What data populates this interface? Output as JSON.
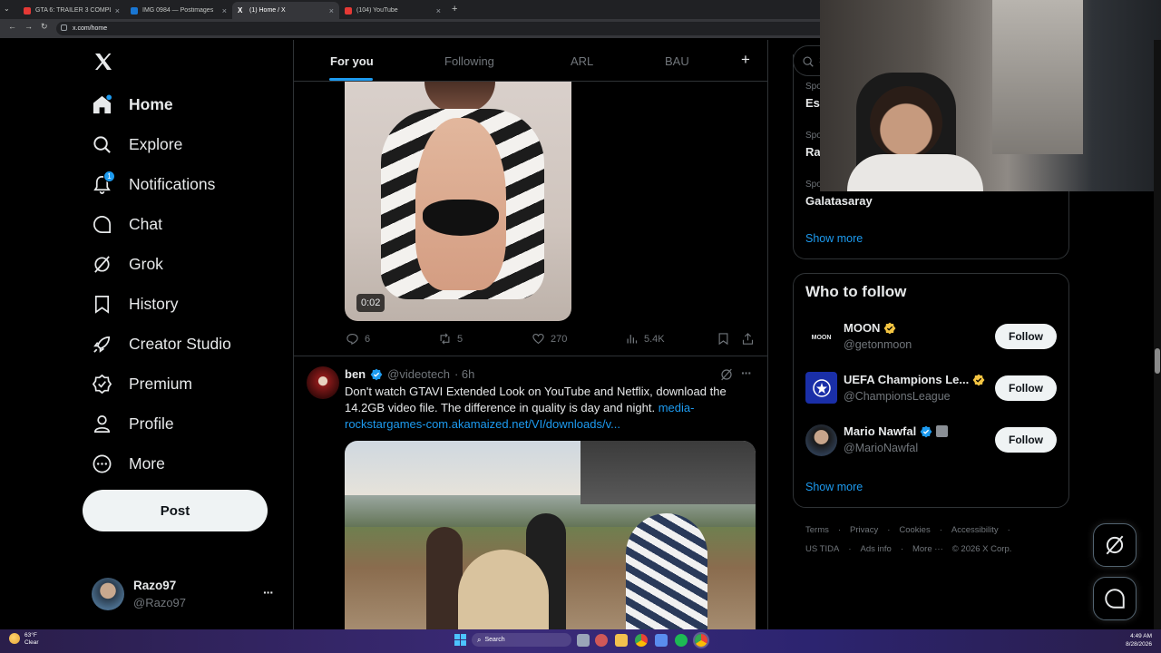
{
  "browser": {
    "tabs": [
      {
        "title": "GTA 6: TRAILER 3 COMPLETO! | ...",
        "favicon_color": "#e53935"
      },
      {
        "title": "IMG 0984 — Postimages",
        "favicon_color": "#1976d2"
      },
      {
        "title": "(1) Home / X",
        "favicon_color": "#ffffff"
      },
      {
        "title": "(104) YouTube",
        "favicon_color": "#e53935"
      }
    ],
    "url": "x.com/home"
  },
  "sidebar": {
    "logo": "X",
    "items": [
      {
        "label": "Home",
        "icon": "home-icon"
      },
      {
        "label": "Explore",
        "icon": "search-icon"
      },
      {
        "label": "Notifications",
        "icon": "bell-icon",
        "badge": "1"
      },
      {
        "label": "Chat",
        "icon": "chat-icon"
      },
      {
        "label": "Grok",
        "icon": "grok-icon"
      },
      {
        "label": "History",
        "icon": "bookmark-icon"
      },
      {
        "label": "Creator Studio",
        "icon": "rocket-icon"
      },
      {
        "label": "Premium",
        "icon": "verified-icon"
      },
      {
        "label": "Profile",
        "icon": "person-icon"
      },
      {
        "label": "More",
        "icon": "more-circle-icon"
      }
    ],
    "post_label": "Post",
    "account": {
      "name": "Razo97",
      "handle": "@Razo97",
      "menu": "···"
    }
  },
  "feed": {
    "tabs": [
      "For you",
      "Following",
      "ARL",
      "BAU"
    ],
    "add_tab": "+",
    "post1": {
      "video_duration": "0:02",
      "replies": "6",
      "reposts": "5",
      "likes": "270",
      "views": "5.4K"
    },
    "post2": {
      "name": "ben",
      "handle": "@videotech",
      "time": "· 6h",
      "text": "Don't watch GTAVI Extended Look on YouTube and Netflix, download the 14.2GB video file. The difference in quality is day and night.",
      "link": "media-rockstargames-com.akamaized.net/VI/downloads/v..."
    }
  },
  "right": {
    "search_placeholder": "S",
    "trends": [
      {
        "category": "Spo",
        "name": "Est"
      },
      {
        "category": "Spo",
        "name": "Ra"
      },
      {
        "category": "Spo",
        "name": "Galatasaray"
      }
    ],
    "trends_show_more": "Show more",
    "who_to_follow": {
      "title": "Who to follow",
      "accounts": [
        {
          "name": "MOON",
          "handle": "@getonmoon",
          "avatar_text": "MOON"
        },
        {
          "name": "UEFA Champions Le...",
          "handle": "@ChampionsLeague",
          "avatar_text": ""
        },
        {
          "name": "Mario Nawfal",
          "handle": "@MarioNawfal",
          "avatar_text": ""
        }
      ],
      "follow_label": "Follow",
      "show_more": "Show more"
    },
    "footer": {
      "row1": [
        "Terms",
        "Privacy",
        "Cookies",
        "Accessibility"
      ],
      "row2": [
        "US TIDA",
        "Ads info",
        "More ···",
        "© 2026 X Corp."
      ]
    }
  },
  "taskbar": {
    "weather_temp": "63°F",
    "weather_text": "Clear",
    "search_label": "Search",
    "time": "4:49 AM",
    "date": "8/28/2026"
  },
  "colors": {
    "accent": "#1d9bf0",
    "background": "#000000",
    "border": "#2f3336",
    "muted": "#71767b",
    "gold_verified": "#f4c542"
  }
}
